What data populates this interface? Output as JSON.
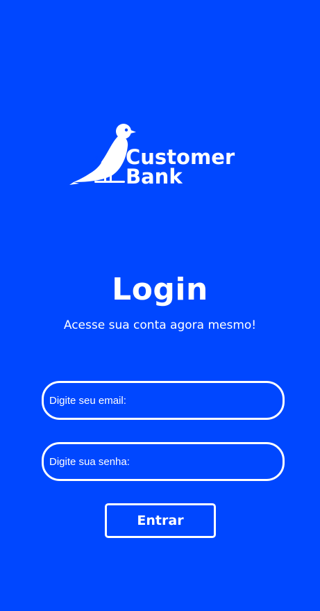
{
  "brand": {
    "name_line1": "Customer",
    "name_line2": "Bank",
    "logo_icon": "bird-icon"
  },
  "login": {
    "title": "Login",
    "subtitle": "Acesse sua conta agora mesmo!"
  },
  "form": {
    "email_placeholder": "Digite seu email:",
    "password_placeholder": "Digite sua senha:",
    "submit_label": "Entrar"
  },
  "colors": {
    "background": "#0047ff",
    "foreground": "#ffffff"
  }
}
